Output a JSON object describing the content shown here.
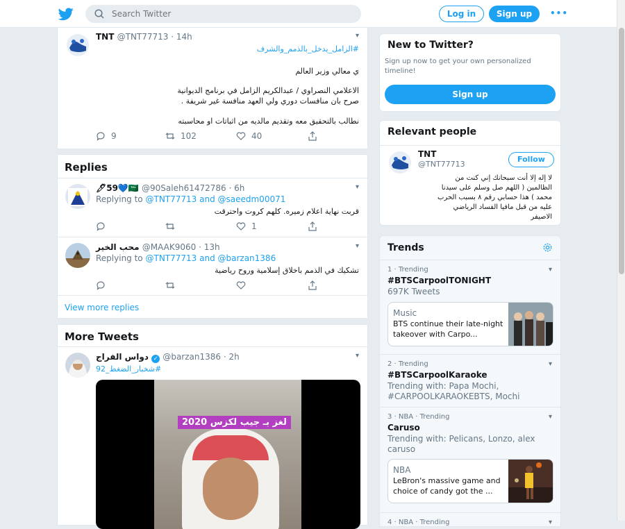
{
  "header": {
    "search_placeholder": "Search Twitter",
    "login_label": "Log in",
    "signup_label": "Sign up",
    "more_label": "•••"
  },
  "main_tweet": {
    "display_name": "TNT",
    "handle_time": "@TNT77713 · 14h",
    "hashtag": "#الزامل_يدخل_بالذمم_والشرف",
    "lines": [
      "ي معالي وزير العالم",
      "الاعلامي النصراوي / عبدالكريم الزامل في برنامج الديوانية",
      "صرح بان منافسات دوري ولي العهد منافسة غير شريفة .",
      "نطالب بالتحقيق معه وتقديم مالديه من اثباتات او محاسبته"
    ],
    "replies": "9",
    "retweets": "102",
    "likes": "40"
  },
  "replies_section": {
    "title": "Replies",
    "items": [
      {
        "display_name": "🖊59💙🇸🇦",
        "handle_time": "@90Saleh61472786 · 6h",
        "replying_prefix": "Replying to",
        "replying_to": "@TNT77713 and @saeedm00071",
        "text": "قربت نهاية اعلام زميره. كلهم كروت واحترقت",
        "replies": "",
        "retweets": "",
        "likes": "1"
      },
      {
        "display_name": "محب الخير",
        "handle_time": "@MAAK9060 · 13h",
        "replying_prefix": "Replying to",
        "replying_to": "@TNT77713 and @barzan1386",
        "text": "تشكيك في الذمم  باخلاق إسلامية  وروح رياضية",
        "replies": "",
        "retweets": "",
        "likes": ""
      }
    ],
    "view_more": "View more replies"
  },
  "more_tweets": {
    "title": "More Tweets",
    "tweet": {
      "display_name": "دواس الفراج",
      "handle_time": "@barzan1386 · 2h",
      "hashtag": "#شخبار_الضغط_92",
      "video_caption": "لغز بـ جيب لكزس 2020"
    }
  },
  "new_to_twitter": {
    "title": "New to Twitter?",
    "text": "Sign up now to get your own personalized timeline!",
    "button": "Sign up"
  },
  "relevant_people": {
    "title": "Relevant people",
    "name": "TNT",
    "handle": "@TNT77713",
    "follow_label": "Follow",
    "bio_lines": [
      "لا إله إلا أنت سبحانك إني كنت من",
      "الظالمين ( اللهم صل وسلم على سيدنا",
      "محمد ) هذا حسابي رقم ٨ بسبب الحرب",
      "عليه من قبل مافيا الفساد الرياضي",
      "الاصيفر"
    ]
  },
  "trends": {
    "title": "Trends",
    "items": [
      {
        "meta": "1 · Trending",
        "name": "#BTSCarpoolTONIGHT",
        "sub": "697K Tweets",
        "card": {
          "category": "Music",
          "text": "BTS continue their late-night takeover with Carpo..."
        }
      },
      {
        "meta": "2 · Trending",
        "name": "#BTSCarpoolKaraoke",
        "sub": "Trending with: Papa Mochi, #CARPOOLKARAOKEBTS, Mochi"
      },
      {
        "meta": "3 · NBA · Trending",
        "name": "Caruso",
        "sub": "Trending with: Pelicans, Lonzo, alex caruso",
        "card": {
          "category": "NBA",
          "text": "LeBron's massive game and choice of candy got the ..."
        }
      },
      {
        "meta": "4 · NBA · Trending"
      }
    ]
  },
  "colors": {
    "accent": "#1da1f2",
    "background": "#e6ecf0",
    "text_secondary": "#657786"
  }
}
